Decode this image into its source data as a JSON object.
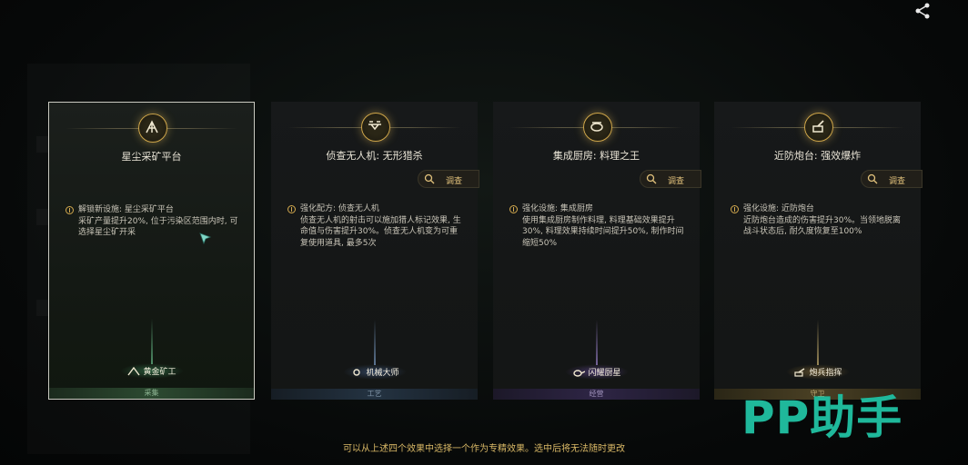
{
  "hint": "可以从上述四个效果中选择一个作为专精效果。选中后将无法随时更改",
  "watermark": "PP助手",
  "search_label": "调查",
  "colors": {
    "accent": "#d9b866",
    "selected_border": "#c9c9c0",
    "watermark": "#1fb89b"
  },
  "cards": [
    {
      "title": "星尘采矿平台",
      "icon": "mining-platform-icon",
      "effect_head": "解锁新设施: 星尘采矿平台",
      "effect_body": "采矿产量提升20%, 位于污染区范围内时, 可选择星尘矿开采",
      "badge": "黄金矿工",
      "category": "采集",
      "selected": true,
      "has_search": false
    },
    {
      "title": "侦查无人机: 无形猎杀",
      "icon": "drone-icon",
      "effect_head": "强化配方: 侦查无人机",
      "effect_body": "侦查无人机的射击可以施加猎人标记效果, 生命值与伤害提升30%。侦查无人机变为可重复使用道具, 最多5次",
      "badge": "机械大师",
      "category": "工艺",
      "selected": false,
      "has_search": true
    },
    {
      "title": "集成厨房: 料理之王",
      "icon": "kitchen-icon",
      "effect_head": "强化设施: 集成厨房",
      "effect_body": "使用集成厨房制作料理, 料理基础效果提升30%, 料理效果持续时间提升50%, 制作时间缩短50%",
      "badge": "闪耀厨星",
      "category": "经营",
      "selected": false,
      "has_search": true
    },
    {
      "title": "近防炮台: 强效爆炸",
      "icon": "turret-icon",
      "effect_head": "强化设施: 近防炮台",
      "effect_body": "近防炮台造成的伤害提升30%。当领地脱离战斗状态后, 耐久度恢复至100%",
      "badge": "炮兵指挥",
      "category": "守卫",
      "selected": false,
      "has_search": true
    }
  ]
}
